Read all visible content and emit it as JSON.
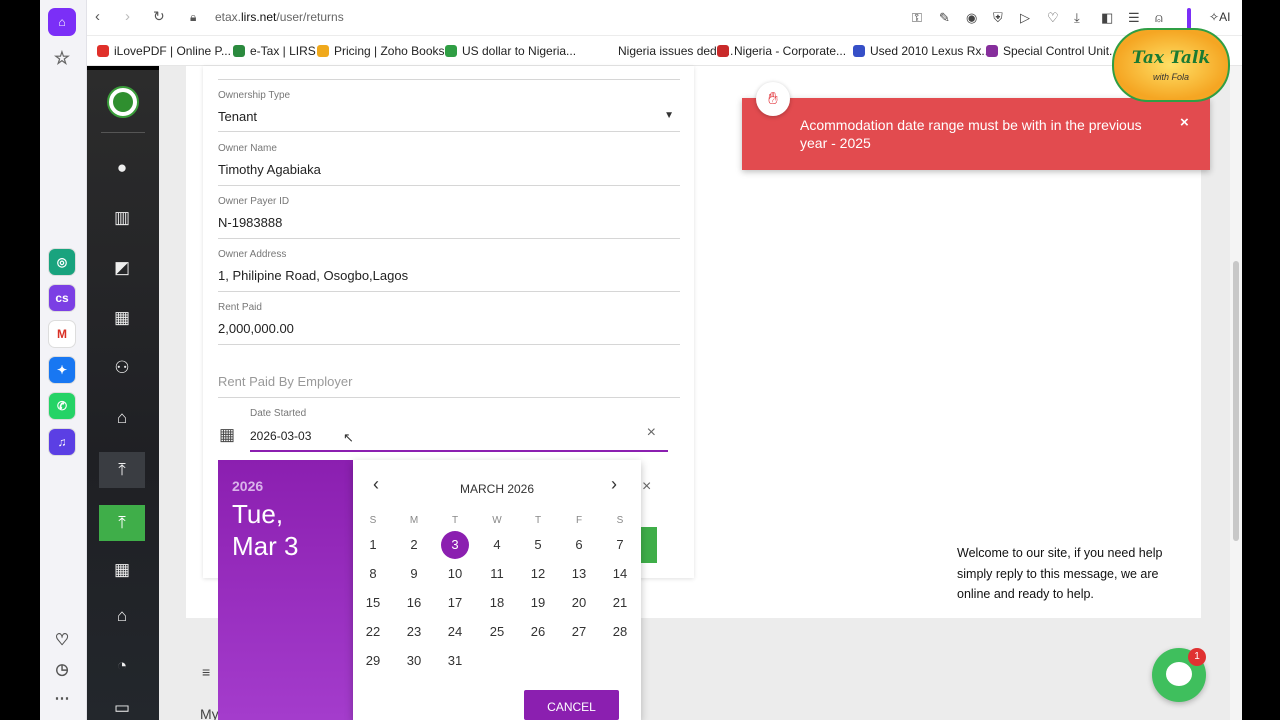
{
  "browser": {
    "url_prefix": "etax.",
    "url_domain": "lirs.net",
    "url_path": "/user/returns",
    "ai_label": "AI",
    "bookmarks": [
      {
        "label": "iLovePDF | Online P...",
        "color": "#e0302a"
      },
      {
        "label": "e-Tax | LIRS",
        "color": "#2b8a3e"
      },
      {
        "label": "Pricing | Zoho Books",
        "color": "#f0a91c"
      },
      {
        "label": "US dollar to Nigeria...",
        "color": "#2f9e44"
      },
      {
        "label": "Nigeria issues dedu...",
        "color": "#ffffff"
      },
      {
        "label": "Nigeria - Corporate...",
        "color": "#c92a2a"
      },
      {
        "label": "Used 2010 Lexus Rx...",
        "color": "#364fc7"
      },
      {
        "label": "Special Control Unit...",
        "color": "#862e9c"
      }
    ],
    "rail_apps": [
      {
        "name": "chatgpt-icon",
        "glyph": "◎",
        "bg": "#19a37e"
      },
      {
        "name": "cs-app-icon",
        "glyph": "cs",
        "bg": "#7b3fe4"
      },
      {
        "name": "gmail-icon",
        "glyph": "M",
        "bg": "#ffffff"
      },
      {
        "name": "messenger-icon",
        "glyph": "✦",
        "bg": "#1877f2"
      },
      {
        "name": "whatsapp-icon",
        "glyph": "✆",
        "bg": "#25d366"
      },
      {
        "name": "music-icon",
        "glyph": "♫",
        "bg": "#5b3fe4"
      }
    ]
  },
  "form": {
    "ownership_type_label": "Ownership Type",
    "ownership_type_value": "Tenant",
    "owner_name_label": "Owner Name",
    "owner_name_value": "Timothy Agabiaka",
    "owner_payer_id_label": "Owner Payer ID",
    "owner_payer_id_value": "N-1983888",
    "owner_address_label": "Owner Address",
    "owner_address_value": "1, Philipine Road, Osogbo,Lagos",
    "rent_paid_label": "Rent Paid",
    "rent_paid_value": "2,000,000.00",
    "rent_paid_by_employer_placeholder": "Rent Paid By Employer",
    "date_started_label": "Date Started",
    "date_started_value": "2026-03-03",
    "partial_menu_text": "My"
  },
  "toast": {
    "message": "Acommodation date range must be with in the previous year - 2025",
    "close_glyph": "×"
  },
  "datepicker": {
    "year": "2026",
    "weekday": "Tue,",
    "monthday": "Mar 3",
    "month_label": "MARCH 2026",
    "prev_glyph": "‹",
    "next_glyph": "›",
    "weekdays": [
      "S",
      "M",
      "T",
      "W",
      "T",
      "F",
      "S"
    ],
    "first_weekday_index": 0,
    "days_in_month": 31,
    "selected_day": 3,
    "cancel_label": "CANCEL"
  },
  "chat": {
    "welcome": "Welcome to our site, if you need help simply reply to this message, we are online and ready to help.",
    "badge_count": "1"
  },
  "watermark": {
    "line1": "Tax Talk",
    "line2": "with Fola"
  }
}
